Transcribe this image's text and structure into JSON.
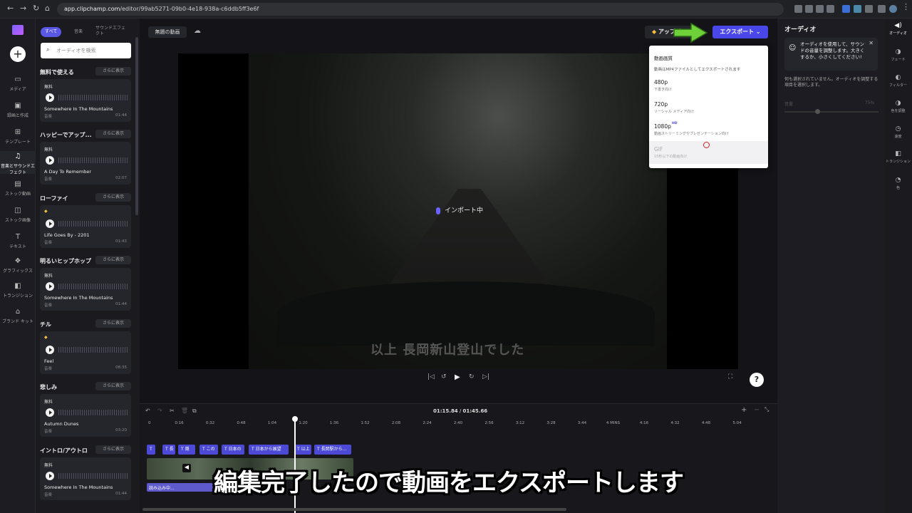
{
  "browser": {
    "url_host": "app.clipchamp.com",
    "url_path": "/editor/99ab5271-09b0-4e18-938a-c6ddb5ff3e6f"
  },
  "rail": {
    "items": [
      {
        "label": "メディア",
        "icon": "folder-icon"
      },
      {
        "label": "録画と作成",
        "icon": "camera-icon"
      },
      {
        "label": "テンプレート",
        "icon": "template-icon"
      },
      {
        "label": "音楽とサウンドエフェクト",
        "icon": "music-icon"
      },
      {
        "label": "ストック動画",
        "icon": "film-icon"
      },
      {
        "label": "ストック画像",
        "icon": "image-icon"
      },
      {
        "label": "テキスト",
        "icon": "text-icon"
      },
      {
        "label": "グラフィックス",
        "icon": "shapes-icon"
      },
      {
        "label": "トランジション",
        "icon": "transition-icon"
      },
      {
        "label": "ブランド キット",
        "icon": "brand-icon"
      }
    ]
  },
  "panel": {
    "tabs": [
      "すべて",
      "音楽",
      "サウンドエフェクト"
    ],
    "search_placeholder": "オーディオを検索",
    "more_label": "さらに表示",
    "sections": [
      {
        "title": "無料で使える",
        "badge": "無料",
        "track": "Somewhere In The Mountains",
        "type": "音楽",
        "duration": "01:44"
      },
      {
        "title": "ハッピーでアップ...",
        "badge": "無料",
        "track": "A Day To Remember",
        "type": "音楽",
        "duration": "02:07"
      },
      {
        "title": "ローファイ",
        "badge": "",
        "track": "Life Goes By - 2201",
        "type": "音楽",
        "duration": "01:43"
      },
      {
        "title": "明るいヒップホップ",
        "badge": "無料",
        "track": "Somewhere In The Mountains",
        "type": "音楽",
        "duration": "01:44"
      },
      {
        "title": "チル",
        "badge": "",
        "track": "Feel",
        "type": "音楽",
        "duration": "08:35"
      },
      {
        "title": "悲しみ",
        "badge": "無料",
        "track": "Autumn Dunes",
        "type": "音楽",
        "duration": "03:20"
      },
      {
        "title": "イントロ/アウトロ",
        "badge": "無料",
        "track": "Somewhere In The Mountains",
        "type": "音楽",
        "duration": "01:44"
      }
    ]
  },
  "editor": {
    "title": "無題の動画",
    "upgrade_label": "アップグレ",
    "export_label": "エクスポート",
    "importing_label": "インポート中",
    "video_caption": "以上 長岡新山登山でした",
    "help_label": "?"
  },
  "dropdown": {
    "header": "動画画質",
    "description": "動画はMP4ファイルとしてエクスポートされます",
    "options": [
      {
        "label": "480p",
        "sub": "下書き向け",
        "tag": ""
      },
      {
        "label": "720p",
        "sub": "ソーシャル メディア向け",
        "tag": ""
      },
      {
        "label": "1080p",
        "sub": "動画ストリーミングやプレゼンテーション向け",
        "tag": "HD"
      },
      {
        "label": "GIF",
        "sub": "15秒以下の動画向け",
        "tag": ""
      }
    ]
  },
  "timeline": {
    "current_time": "01:15.84",
    "total_time": "01:45.66",
    "ticks": [
      "0",
      "0:16",
      "0:32",
      "0:48",
      "1:04",
      "1:20",
      "1:36",
      "1:52",
      "2:08",
      "2:24",
      "2:40",
      "2:56",
      "3:12",
      "3:28",
      "3:44",
      "4 MINS",
      "4:16",
      "4:32",
      "4:48",
      "5:04"
    ],
    "text_clips": [
      "T",
      "T 長",
      "T 隠",
      "T この",
      "T 日本の",
      "T 日本から展望",
      "T 以上",
      "T 長岡駅から..."
    ],
    "audio_clip": "読み込み中..."
  },
  "props": {
    "title": "オーディオ",
    "tip": "オーディオを使用して、サウンドの音量を調整します。大きくするか、小さくしてください!",
    "no_selection": "何も選択されていません。オーディオを調整する項目を選択します。",
    "volume_label": "音量",
    "volume_value": "75%",
    "volume_level": 0.35
  },
  "right_tabs": [
    "オーディオ",
    "フェード",
    "フィルター",
    "色を調整",
    "速度",
    "トランジション",
    "色"
  ],
  "subtitle": "編集完了したので動画をエクスポートします"
}
